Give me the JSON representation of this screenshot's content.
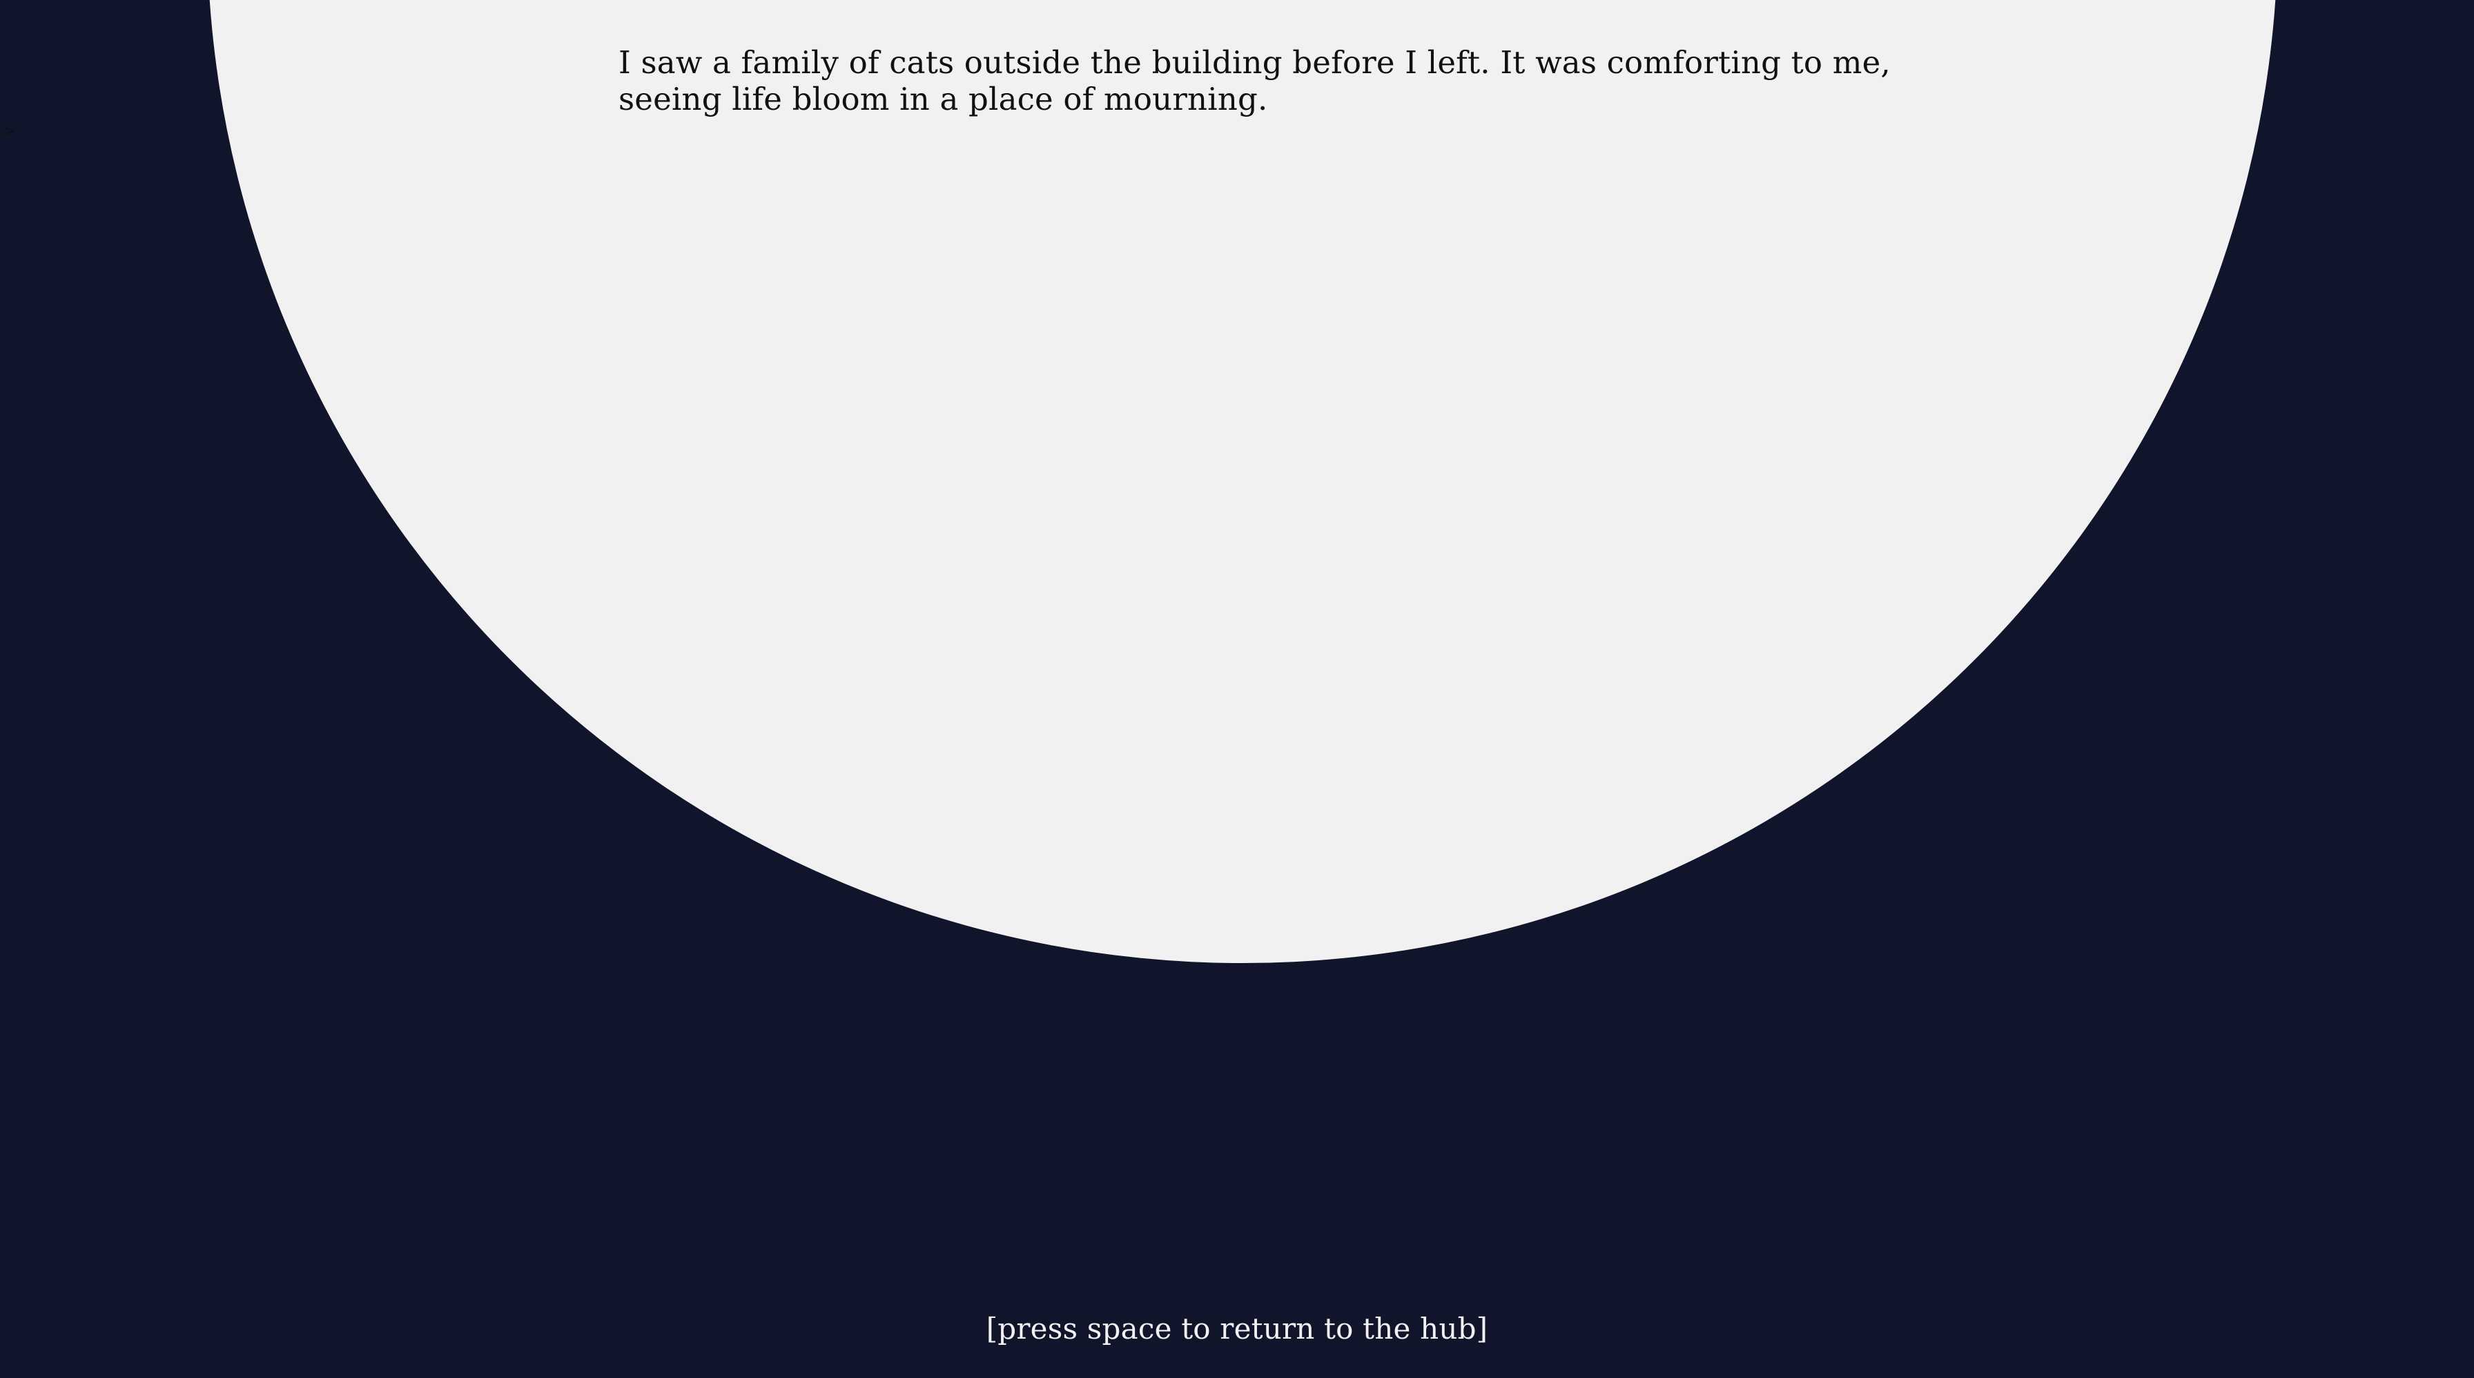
{
  "scene": {
    "colors": {
      "background": "#11152b",
      "panel": "#f1f1f1",
      "text_dark": "#111111",
      "text_light": "#f1f1f1"
    },
    "cursor_icon": "arrow-cursor-icon",
    "cursor_glyph": ">",
    "story": {
      "lines": [
        "I saw a family of cats outside the building before I left. It was comforting to me,",
        "seeing life bloom in a place of mourning."
      ]
    },
    "return_hint": "[press space to return to the hub]"
  }
}
